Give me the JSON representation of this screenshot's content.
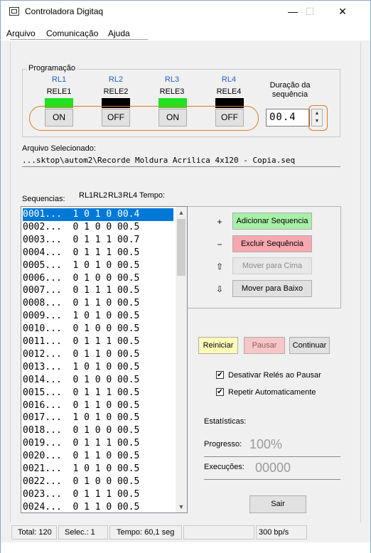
{
  "window": {
    "title": "Controladora Digitaq",
    "minimize": "—",
    "maximize": "☐",
    "close": "✕"
  },
  "menu": [
    "Arquivo",
    "Comunicação",
    "Ajuda"
  ],
  "programacao": {
    "title": "Programação",
    "relays": [
      {
        "rl": "RL1",
        "name": "RELE1",
        "state": "ON",
        "led_color": "#22e022"
      },
      {
        "rl": "RL2",
        "name": "RELE2",
        "state": "OFF",
        "led_color": "#000000"
      },
      {
        "rl": "RL3",
        "name": "RELE3",
        "state": "ON",
        "led_color": "#22e022"
      },
      {
        "rl": "RL4",
        "name": "RELE4",
        "state": "OFF",
        "led_color": "#000000"
      }
    ],
    "duration_label": "Duração da sequência",
    "duration_value": "00.4"
  },
  "file": {
    "label": "Arquivo Selecionado:",
    "path": "...sktop\\autom2\\Recorde Moldura Acrilica 4x120 - Copia.seq"
  },
  "sequences": {
    "label": "Sequencias:",
    "columns": [
      "RL1",
      "RL2",
      "RL3",
      "RL4",
      "Tempo:"
    ],
    "rows": [
      "0001...  1 0 1 0 00.4",
      "0002...  0 1 0 0 00.5",
      "0003...  0 1 1 1 00.7",
      "0004...  0 1 1 1 00.5",
      "0005...  1 0 1 0 00.5",
      "0006...  0 1 0 0 00.5",
      "0007...  0 1 1 1 00.5",
      "0008...  0 1 1 0 00.5",
      "0009...  1 0 1 0 00.5",
      "0010...  0 1 0 0 00.5",
      "0011...  0 1 1 1 00.5",
      "0012...  0 1 1 0 00.5",
      "0013...  1 0 1 0 00.5",
      "0014...  0 1 0 0 00.5",
      "0015...  0 1 1 1 00.5",
      "0016...  0 1 1 0 00.5",
      "0017...  1 0 1 0 00.5",
      "0018...  0 1 0 0 00.5",
      "0019...  0 1 1 1 00.5",
      "0020...  0 1 1 0 00.5",
      "0021...  1 0 1 0 00.5",
      "0022...  0 1 0 0 00.5",
      "0023...  0 1 1 1 00.5",
      "0024...  0 1 1 0 00.5"
    ],
    "selected_index": 0
  },
  "seq_buttons": {
    "add": "Adicionar Sequencia",
    "delete": "Excluir Sequência",
    "move_up": "Mover para Cima",
    "move_down": "Mover para Baixo",
    "add_icon": "+",
    "delete_icon": "−",
    "up_icon": "⇧",
    "down_icon": "⇩"
  },
  "controls": {
    "restart": "Reiniciar",
    "pause": "Pausar",
    "continue": "Continuar"
  },
  "options": {
    "disable_relays": {
      "label": "Desativar Relés ao Pausar",
      "checked": true
    },
    "auto_repeat": {
      "label": "Repetir Automaticamente",
      "checked": true
    }
  },
  "stats": {
    "title": "Estatísticas:",
    "progress_label": "Progresso:",
    "progress_value": "100%",
    "runs_label": "Execuções:",
    "runs_value": "00000"
  },
  "exit": "Sair",
  "status": {
    "total": "Total: 120",
    "selected": "Selec.: 1",
    "time": "Tempo: 60,1 seg",
    "empty": "",
    "speed": "300 bp/s"
  },
  "colors": {
    "add_btn": "#a8f0a8",
    "delete_btn": "#f7a7b0",
    "restart_btn": "#fffcb8",
    "pause_btn": "#f7c6c6",
    "selection": "#0078d7",
    "accent_outline": "#e07a1f"
  }
}
